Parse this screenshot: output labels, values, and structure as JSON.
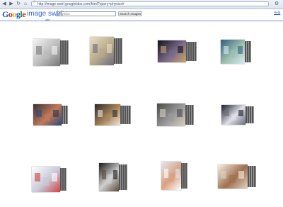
{
  "browser": {
    "url": "http://image-swirl.googlelabs.com/html?query=physics#",
    "back_icon": "back-arrow-icon",
    "forward_icon": "forward-arrow-icon",
    "reload_icon": "reload-icon",
    "home_icon": "home-icon",
    "bookmark_icon": "star-icon",
    "menu_icon": "wrench-icon"
  },
  "header": {
    "logo": {
      "g1": "G",
      "o1": "o",
      "o2": "o",
      "g2": "g",
      "l": "l",
      "e": "e"
    },
    "app_name": "image swirl",
    "labs_label": "labs",
    "search_value": "physics",
    "search_button": "Search Images",
    "help_link": "Help",
    "colors": {
      "blue": "#1a56d6",
      "red": "#d62d20",
      "yellow": "#f0b400",
      "green": "#109946"
    }
  },
  "thumbnails": [
    {
      "name": "thumb-sketch-diagram",
      "layers": 4,
      "colors": [
        "#f4f4f4",
        "#bbbbbb",
        "#777777"
      ]
    },
    {
      "name": "thumb-comic-strip",
      "layers": 4,
      "colors": [
        "#e8e0c4",
        "#b7a98a",
        "#6b6b7d"
      ]
    },
    {
      "name": "thumb-planets",
      "layers": 5,
      "colors": [
        "#101018",
        "#7a6a8a",
        "#c9a46a"
      ]
    },
    {
      "name": "thumb-collage",
      "layers": 3,
      "colors": [
        "#2f5f7f",
        "#9fc0b0",
        "#d9e9f5"
      ]
    },
    {
      "name": "thumb-group-photo",
      "layers": 3,
      "colors": [
        "#3a3038",
        "#c07a5a",
        "#2a4a7a"
      ]
    },
    {
      "name": "thumb-lab-room",
      "layers": 5,
      "colors": [
        "#2a2a2a",
        "#a8855a",
        "#efe7d8"
      ]
    },
    {
      "name": "thumb-hallway-people",
      "layers": 4,
      "colors": [
        "#4a4a4a",
        "#9a9a9a",
        "#d8d0c0"
      ]
    },
    {
      "name": "thumb-machine",
      "layers": 4,
      "colors": [
        "#1a1a2a",
        "#e0e0e8",
        "#6a6a7a"
      ]
    },
    {
      "name": "thumb-chart-sketch",
      "layers": 3,
      "colors": [
        "#ffffff",
        "#c8c8d8",
        "#d04040"
      ]
    },
    {
      "name": "thumb-dark-photo",
      "layers": 4,
      "colors": [
        "#1a1a1a",
        "#d0d0d0",
        "#5a4a3a"
      ]
    },
    {
      "name": "thumb-portrait",
      "layers": 3,
      "colors": [
        "#e2e8f2",
        "#d8a080",
        "#ffffff"
      ]
    },
    {
      "name": "thumb-webpage",
      "layers": 4,
      "colors": [
        "#f6f0e6",
        "#a07050",
        "#e0d4c0"
      ]
    }
  ]
}
